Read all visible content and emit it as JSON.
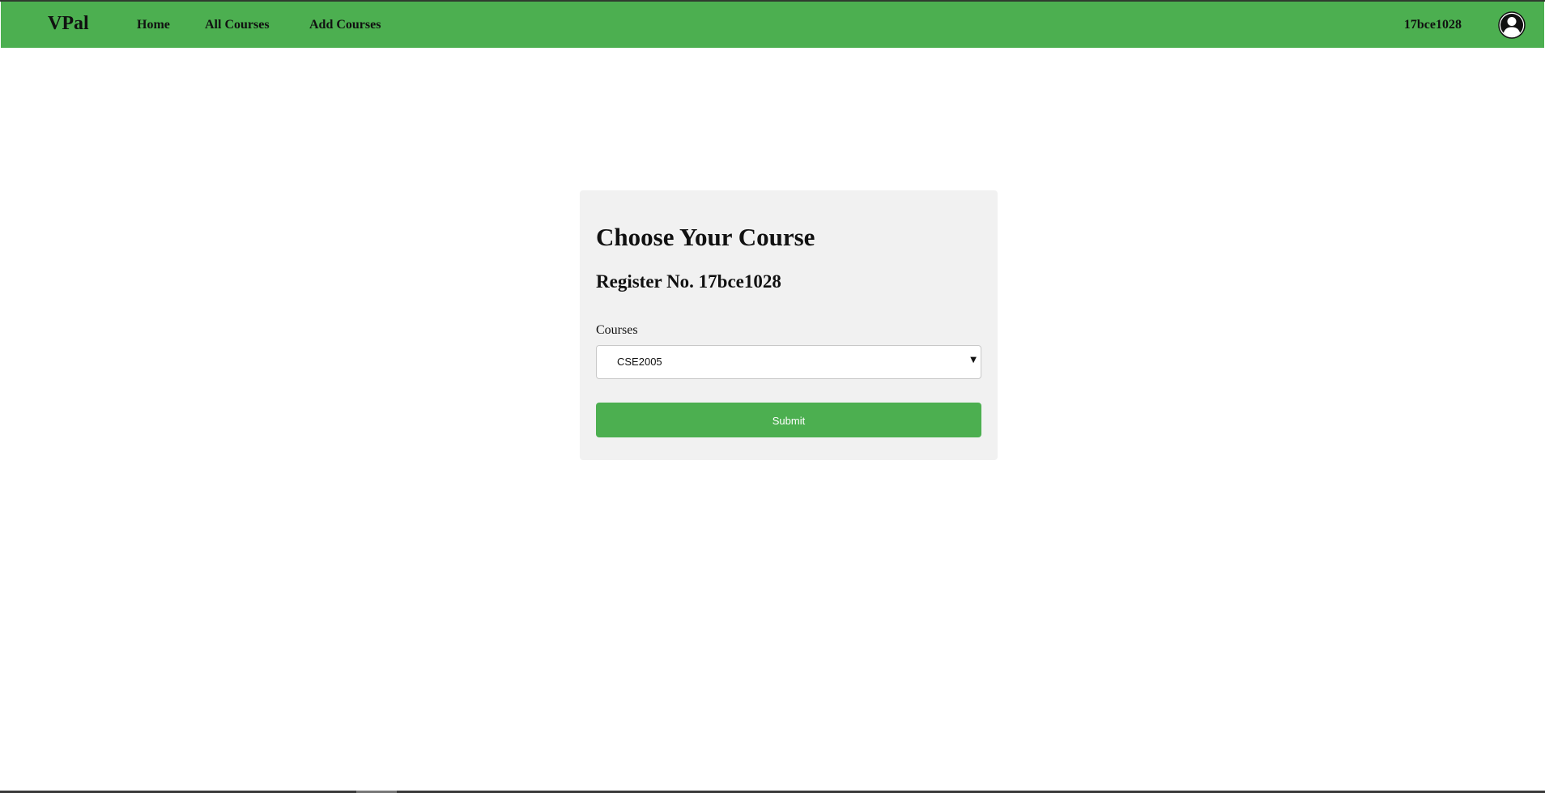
{
  "navbar": {
    "brand": "VPal",
    "links": [
      {
        "label": "Home"
      },
      {
        "label": "All Courses"
      },
      {
        "label": "Add Courses"
      }
    ],
    "username": "17bce1028",
    "avatar_icon": "user-circle-icon",
    "background_color": "#4caf50"
  },
  "card": {
    "title": "Choose Your Course",
    "subtitle": "Register No. 17bce1028",
    "courses_label": "Courses",
    "courses_selected": "CSE2005",
    "dropdown_icon": "caret-down-icon",
    "submit_label": "Submit",
    "background_color": "#f1f1f1",
    "button_color": "#4caf50"
  }
}
